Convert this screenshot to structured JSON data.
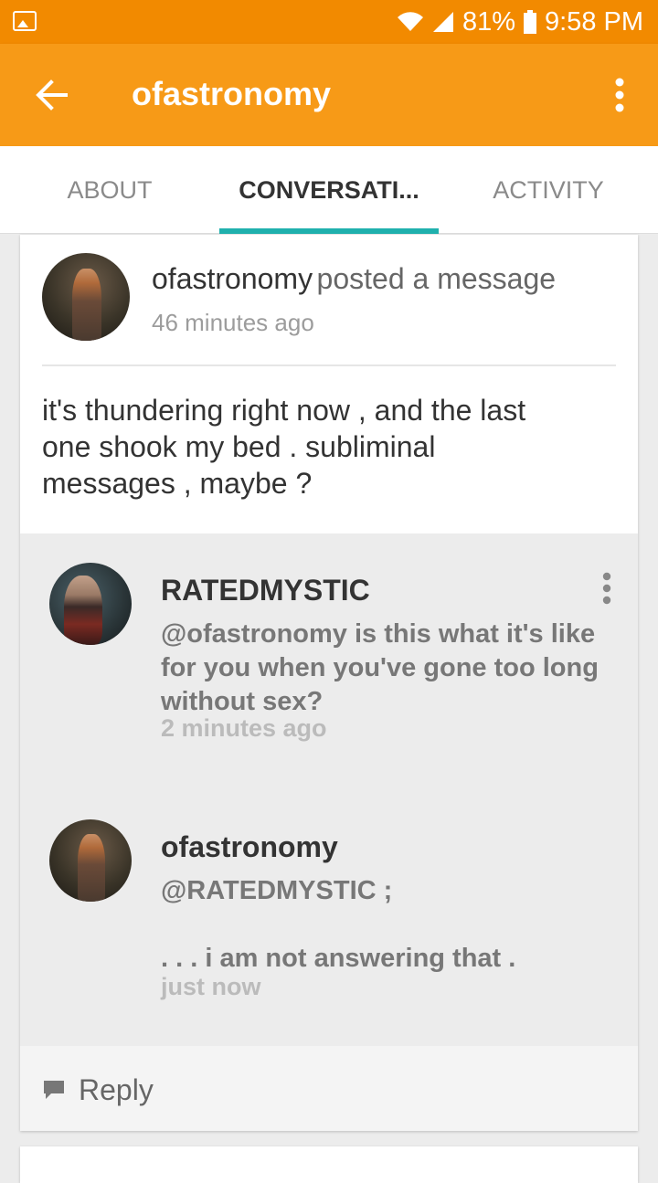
{
  "status": {
    "battery": "81%",
    "time": "9:58 PM"
  },
  "header": {
    "title": "ofastronomy"
  },
  "tabs": [
    {
      "label": "ABOUT"
    },
    {
      "label": "CONVERSATI..."
    },
    {
      "label": "ACTIVITY"
    }
  ],
  "post": {
    "author": "ofastronomy",
    "action": "posted a message",
    "time": "46 minutes ago",
    "body": "it's thundering right now , and the last one shook my bed . subliminal messages , maybe ?"
  },
  "comments": [
    {
      "author": "RATEDMYSTIC",
      "text": "@ofastronomy is this what it's like for you when you've gone too long without sex?",
      "time": "2 minutes ago"
    },
    {
      "author": "ofastronomy",
      "text_line1": "@RATEDMYSTIC ;",
      "text_line2": ". . . i am not answering that .",
      "time": "just now"
    }
  ],
  "reply": {
    "label": "Reply"
  },
  "colors": {
    "status_bar": "#f28a00",
    "app_bar": "#f79a17",
    "tab_indicator": "#1fb0ad"
  }
}
